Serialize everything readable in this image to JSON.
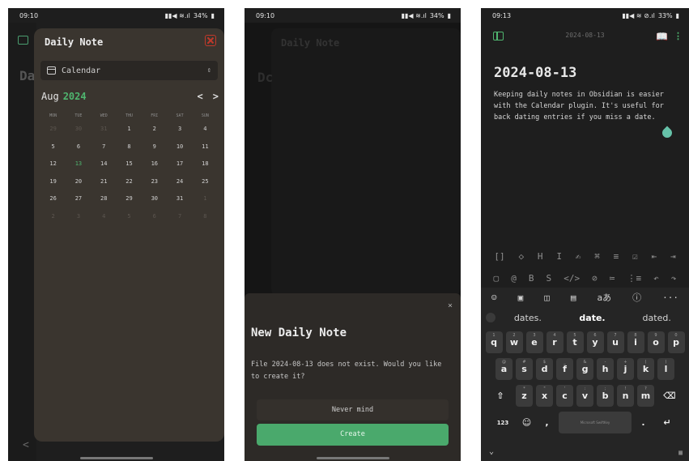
{
  "phone1": {
    "status": {
      "time": "09:10",
      "battery": "34%"
    },
    "side_letter": "Da",
    "drawer": {
      "title": "Daily Note",
      "view_select": "Calendar",
      "month": "Aug",
      "year": "2024",
      "nav_prev": "<",
      "nav_next": ">"
    },
    "calendar": {
      "weekdays": [
        "MON",
        "TUE",
        "WED",
        "THU",
        "FRI",
        "SAT",
        "SUN"
      ],
      "days": [
        {
          "d": "29",
          "dim": true
        },
        {
          "d": "30",
          "dim": true
        },
        {
          "d": "31",
          "dim": true
        },
        {
          "d": "1"
        },
        {
          "d": "2"
        },
        {
          "d": "3"
        },
        {
          "d": "4"
        },
        {
          "d": "5"
        },
        {
          "d": "6"
        },
        {
          "d": "7"
        },
        {
          "d": "8"
        },
        {
          "d": "9"
        },
        {
          "d": "10"
        },
        {
          "d": "11"
        },
        {
          "d": "12"
        },
        {
          "d": "13",
          "today": true
        },
        {
          "d": "14"
        },
        {
          "d": "15"
        },
        {
          "d": "16"
        },
        {
          "d": "17"
        },
        {
          "d": "18"
        },
        {
          "d": "19"
        },
        {
          "d": "20"
        },
        {
          "d": "21"
        },
        {
          "d": "22"
        },
        {
          "d": "23"
        },
        {
          "d": "24"
        },
        {
          "d": "25"
        },
        {
          "d": "26"
        },
        {
          "d": "27"
        },
        {
          "d": "28"
        },
        {
          "d": "29"
        },
        {
          "d": "30"
        },
        {
          "d": "31"
        },
        {
          "d": "1",
          "dim": true
        },
        {
          "d": "2",
          "dim": true
        },
        {
          "d": "3",
          "dim": true
        },
        {
          "d": "4",
          "dim": true
        },
        {
          "d": "5",
          "dim": true
        },
        {
          "d": "6",
          "dim": true
        },
        {
          "d": "7",
          "dim": true
        },
        {
          "d": "8",
          "dim": true
        }
      ]
    },
    "back_chevron": "<"
  },
  "phone2": {
    "status": {
      "time": "09:10",
      "battery": "34%"
    },
    "ghost_title": "Daily Note",
    "ghost_letter": "Dc",
    "sheet": {
      "close": "×",
      "title": "New Daily Note",
      "message": "File 2024-08-13 does not exist. Would you like to create it?",
      "never_mind": "Never mind",
      "create": "Create"
    }
  },
  "phone3": {
    "status": {
      "time": "09:13",
      "battery": "33%"
    },
    "toolbar_title": "2024-08-13",
    "menu_glyph": "⋮",
    "note_title": "2024-08-13",
    "note_body": "Keeping daily notes in Obsidian is easier with the Calendar plugin. It's useful for back dating entries if you miss a date.",
    "format_row1": [
      "[]",
      "◇",
      "H",
      "I",
      "✍",
      "⌘",
      "≡",
      "☑",
      "⇤",
      "⇥"
    ],
    "format_row2": [
      "▢",
      "@",
      "B",
      "S",
      "</>",
      "⊘",
      "≔",
      "⋮≡",
      "↶",
      "↷"
    ],
    "kb_tools": [
      "☺",
      "▣",
      "◫",
      "▤",
      "aあ",
      "ⓘ",
      "···"
    ],
    "suggestions": [
      "dates.",
      "date.",
      "dated."
    ],
    "row1": [
      {
        "k": "q",
        "a": "1"
      },
      {
        "k": "w",
        "a": "2"
      },
      {
        "k": "e",
        "a": "3"
      },
      {
        "k": "r",
        "a": "4"
      },
      {
        "k": "t",
        "a": "5"
      },
      {
        "k": "y",
        "a": "6"
      },
      {
        "k": "u",
        "a": "7"
      },
      {
        "k": "i",
        "a": "8"
      },
      {
        "k": "o",
        "a": "9"
      },
      {
        "k": "p",
        "a": "0"
      }
    ],
    "row2": [
      {
        "k": "a",
        "a": "@"
      },
      {
        "k": "s",
        "a": "#"
      },
      {
        "k": "d",
        "a": "$"
      },
      {
        "k": "f",
        "a": "_"
      },
      {
        "k": "g",
        "a": "&"
      },
      {
        "k": "h",
        "a": "-"
      },
      {
        "k": "j",
        "a": "+"
      },
      {
        "k": "k",
        "a": "("
      },
      {
        "k": "l",
        "a": ")"
      }
    ],
    "row3": [
      {
        "k": "z",
        "a": "*"
      },
      {
        "k": "x",
        "a": "\""
      },
      {
        "k": "c",
        "a": "'"
      },
      {
        "k": "v",
        "a": ":"
      },
      {
        "k": "b",
        "a": ";"
      },
      {
        "k": "n",
        "a": "!"
      },
      {
        "k": "m",
        "a": "?"
      }
    ],
    "shift": "⇧",
    "backspace": "⌫",
    "num_key": "123",
    "emoji_key": "☺",
    "comma_key": ",",
    "space_label": "Microsoft SwiftKey",
    "period_key": ".",
    "enter_key": "↵",
    "collapse_key": "⌄"
  }
}
